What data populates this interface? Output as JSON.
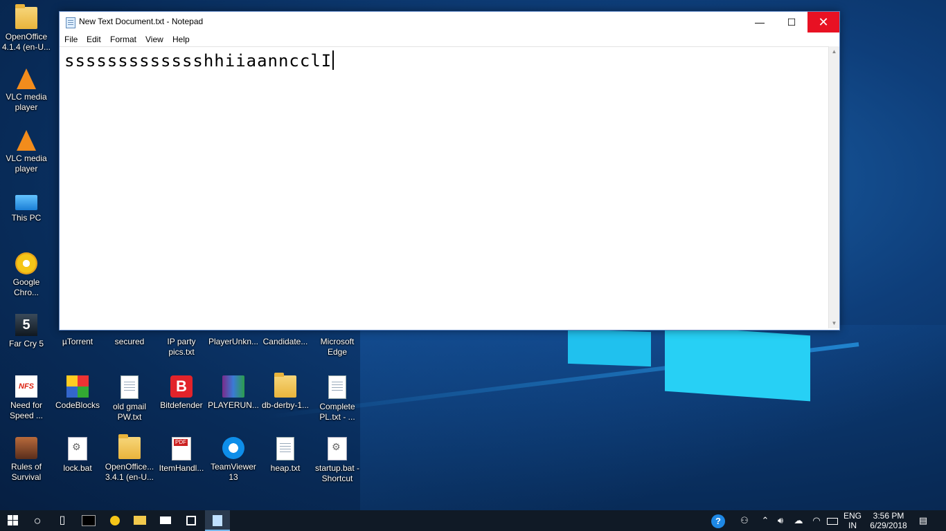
{
  "desktop": {
    "icons_left": [
      {
        "name": "openoffice-414",
        "label": "OpenOffice 4.1.4 (en-U..."
      },
      {
        "name": "vlc-1",
        "label": "VLC media player"
      },
      {
        "name": "vlc-2",
        "label": "VLC media player"
      },
      {
        "name": "this-pc",
        "label": "This PC"
      },
      {
        "name": "google-chrome",
        "label": "Google Chro..."
      },
      {
        "name": "far-cry-5",
        "label": "Far Cry 5"
      },
      {
        "name": "need-for-speed",
        "label": "Need for Speed ..."
      },
      {
        "name": "rules-of-survival",
        "label": "Rules of Survival"
      }
    ],
    "row1": [
      {
        "name": "utorrent",
        "label": "µTorrent"
      },
      {
        "name": "secured",
        "label": "secured"
      },
      {
        "name": "ip-party-pics",
        "label": "IP party pics.txt"
      },
      {
        "name": "playerunknown",
        "label": "PlayerUnkn..."
      },
      {
        "name": "candidate",
        "label": "Candidate..."
      },
      {
        "name": "microsoft-edge",
        "label": "Microsoft Edge"
      }
    ],
    "row2": [
      {
        "name": "codeblocks",
        "label": "CodeBlocks"
      },
      {
        "name": "old-gmail-pw",
        "label": "old gmail PW.txt"
      },
      {
        "name": "bitdefender",
        "label": "Bitdefender"
      },
      {
        "name": "playerun-rar",
        "label": "PLAYERUN..."
      },
      {
        "name": "db-derby",
        "label": "db-derby-1..."
      },
      {
        "name": "complete-pl",
        "label": "Complete PL.txt - ..."
      }
    ],
    "row3": [
      {
        "name": "lock-bat",
        "label": "lock.bat"
      },
      {
        "name": "openoffice-341",
        "label": "OpenOffice... 3.4.1 (en-U..."
      },
      {
        "name": "itemhandl",
        "label": "ItemHandl..."
      },
      {
        "name": "teamviewer",
        "label": "TeamViewer 13"
      },
      {
        "name": "heap-txt",
        "label": "heap.txt"
      },
      {
        "name": "startup-bat",
        "label": "startup.bat - Shortcut"
      }
    ]
  },
  "notepad": {
    "title": "New Text Document.txt - Notepad",
    "minimize": "—",
    "maximize": "☐",
    "close": "✕",
    "menu": [
      "File",
      "Edit",
      "Format",
      "View",
      "Help"
    ],
    "content": "ssssssssssssshhiiaanncclI"
  },
  "taskbar": {
    "start": "Start",
    "search": "○",
    "task_view": "▯",
    "apps": [
      "cmd",
      "chrome",
      "file-explorer",
      "mail",
      "store",
      "notepad"
    ],
    "tray_help": "?",
    "lang_line1": "ENG",
    "lang_line2": "IN",
    "time": "3:56 PM",
    "date": "6/29/2018"
  },
  "colors": {
    "close_red": "#e81123",
    "taskbar": "#101a26",
    "window_border": "#5b84c4"
  }
}
